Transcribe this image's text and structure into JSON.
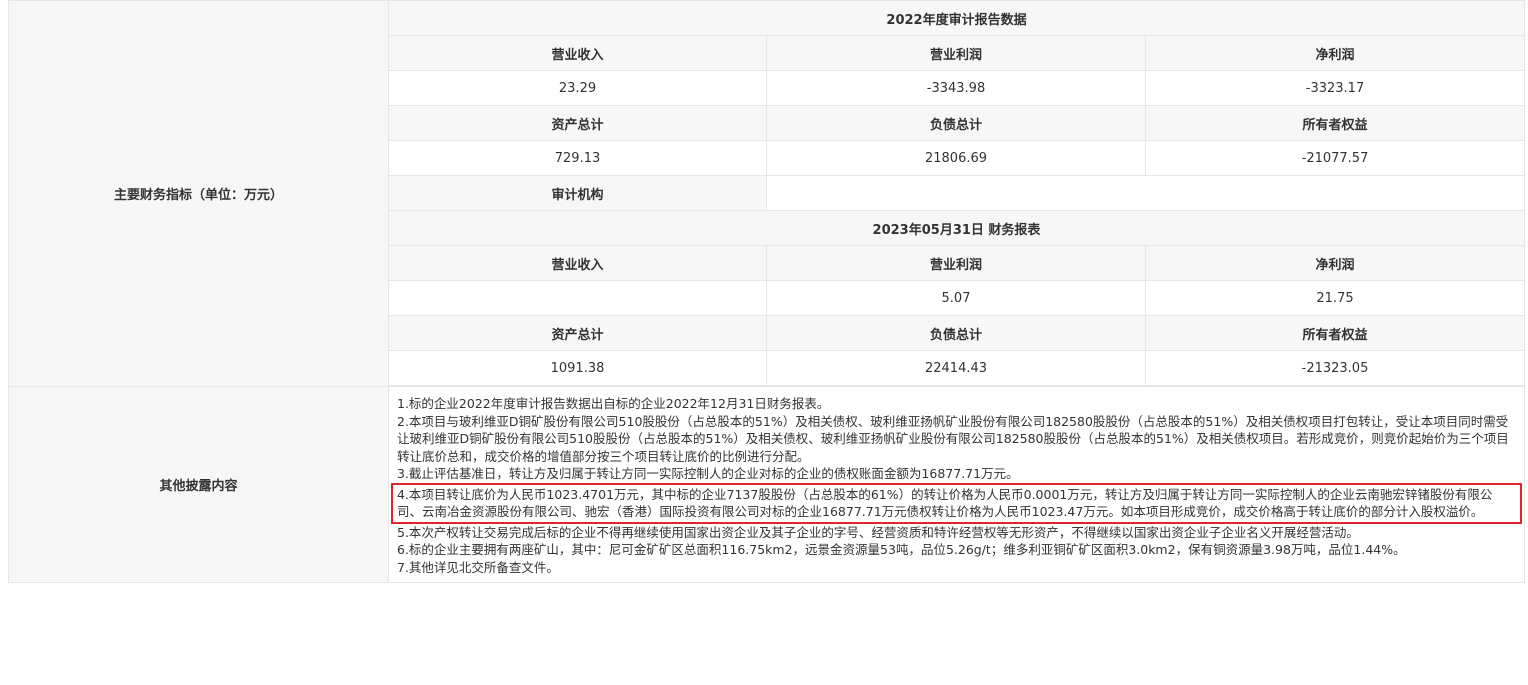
{
  "main_label": "主要财务指标（单位：万元）",
  "section_2022": {
    "title": "2022年度审计报告数据",
    "row1_headers": [
      "营业收入",
      "营业利润",
      "净利润"
    ],
    "row1_values": [
      "23.29",
      "-3343.98",
      "-3323.17"
    ],
    "row2_headers": [
      "资产总计",
      "负债总计",
      "所有者权益"
    ],
    "row2_values": [
      "729.13",
      "21806.69",
      "-21077.57"
    ],
    "audit_label": "审计机构",
    "audit_value": ""
  },
  "section_2023": {
    "title": "2023年05月31日 财务报表",
    "row1_headers": [
      "营业收入",
      "营业利润",
      "净利润"
    ],
    "row1_values": [
      "",
      "5.07",
      "21.75"
    ],
    "row2_headers": [
      "资产总计",
      "负债总计",
      "所有者权益"
    ],
    "row2_values": [
      "1091.38",
      "22414.43",
      "-21323.05"
    ]
  },
  "other_label": "其他披露内容",
  "notes": [
    "1.标的企业2022年度审计报告数据出自标的企业2022年12月31日财务报表。",
    "2.本项目与玻利维亚D铜矿股份有限公司510股股份（占总股本的51%）及相关债权、玻利维亚扬帆矿业股份有限公司182580股股份（占总股本的51%）及相关债权项目打包转让，受让本项目同时需受让玻利维亚D铜矿股份有限公司510股股份（占总股本的51%）及相关债权、玻利维亚扬帆矿业股份有限公司182580股股份（占总股本的51%）及相关债权项目。若形成竞价，则竞价起始价为三个项目转让底价总和，成交价格的增值部分按三个项目转让底价的比例进行分配。",
    "3.截止评估基准日，转让方及归属于转让方同一实际控制人的企业对标的企业的债权账面金额为16877.71万元。",
    "4.本项目转让底价为人民币1023.4701万元，其中标的企业7137股股份（占总股本的61%）的转让价格为人民币0.0001万元，转让方及归属于转让方同一实际控制人的企业云南驰宏锌锗股份有限公司、云南冶金资源股份有限公司、驰宏（香港）国际投资有限公司对标的企业16877.71万元债权转让价格为人民币1023.47万元。如本项目形成竞价，成交价格高于转让底价的部分计入股权溢价。",
    "5.本次产权转让交易完成后标的企业不得再继续使用国家出资企业及其子企业的字号、经营资质和特许经营权等无形资产，不得继续以国家出资企业子企业名义开展经营活动。",
    "6.标的企业主要拥有两座矿山，其中：尼可金矿矿区总面积116.75km2，远景金资源量53吨，品位5.26g/t；维多利亚铜矿矿区面积3.0km2，保有铜资源量3.98万吨，品位1.44%。",
    "7.其他详见北交所备查文件。"
  ],
  "highlight_color": "#e0262b"
}
